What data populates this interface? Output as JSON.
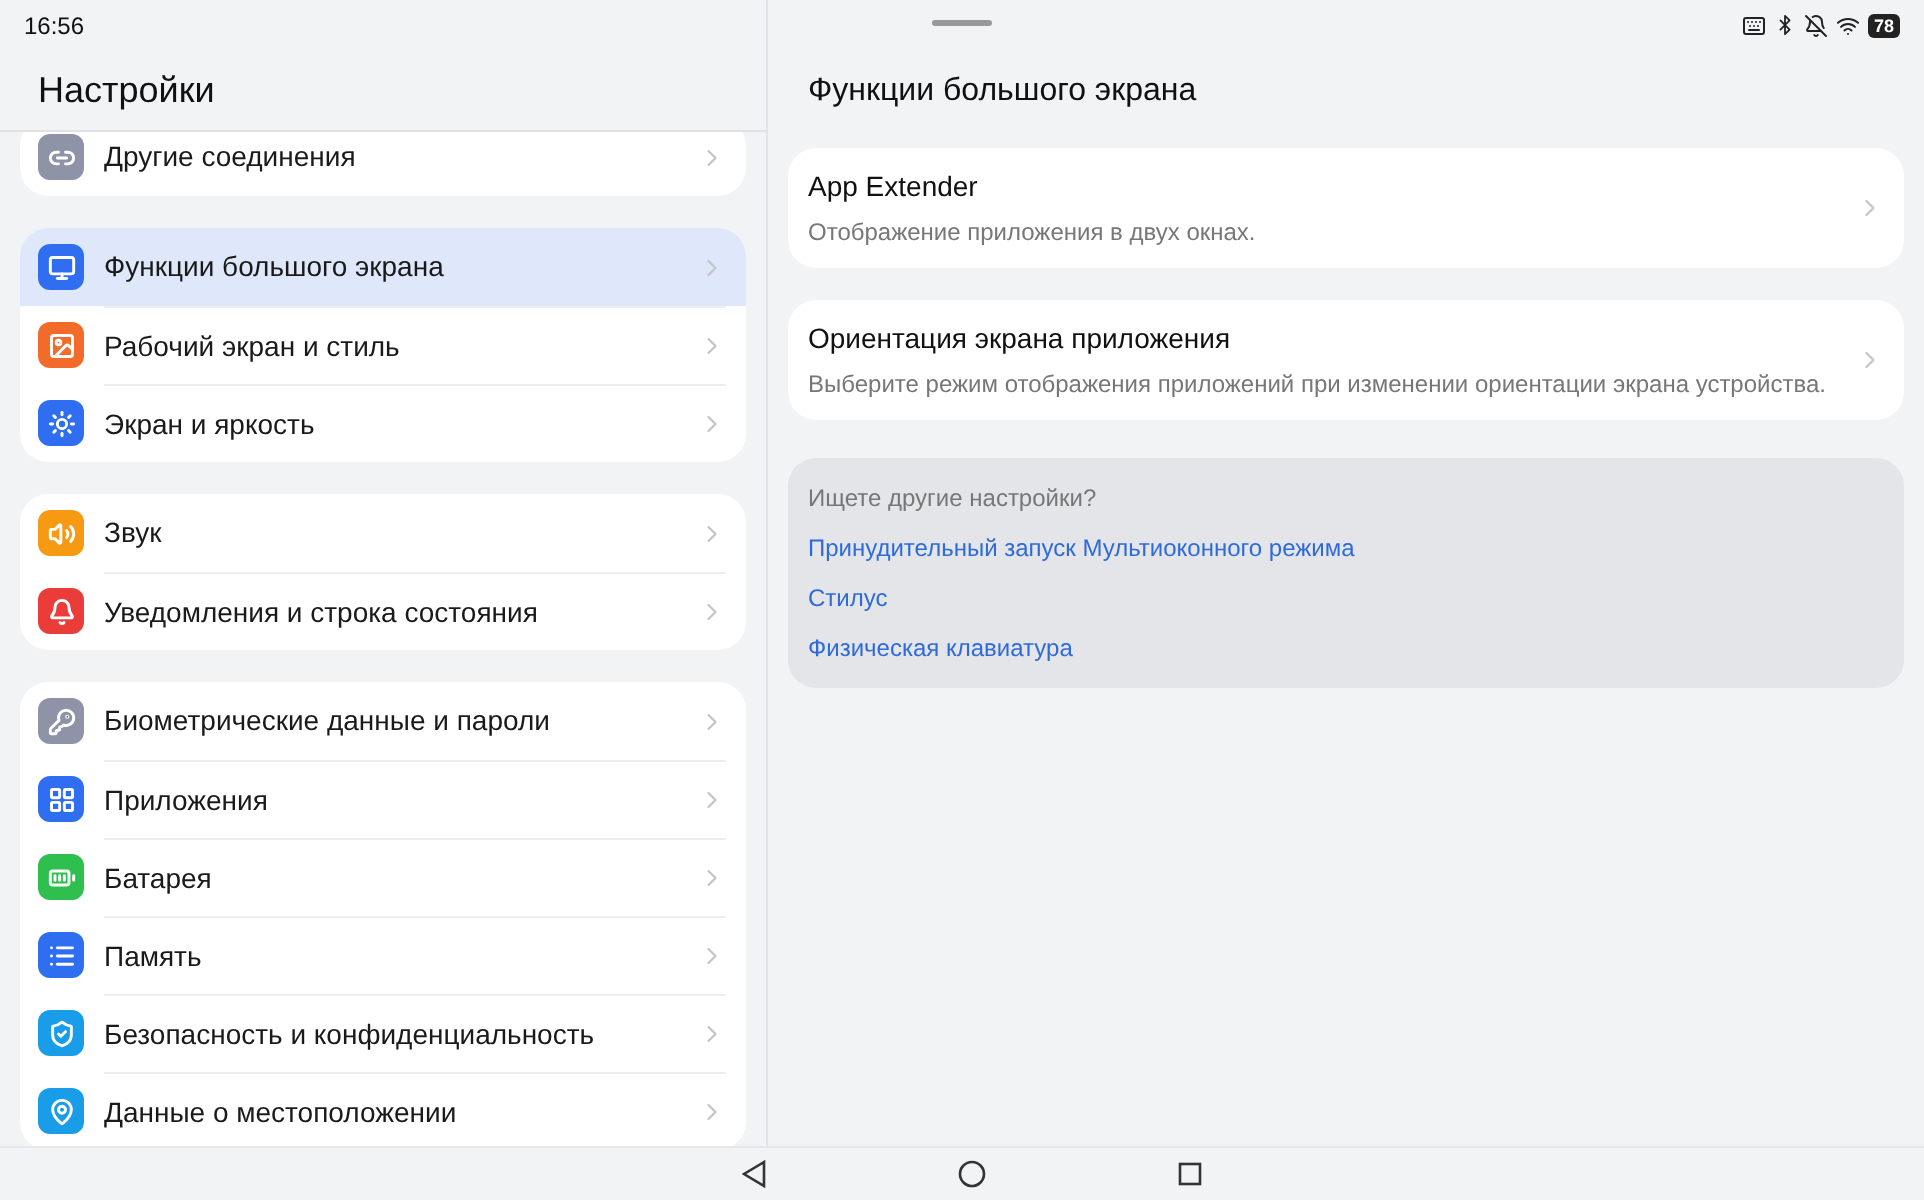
{
  "status_bar": {
    "time": "16:56",
    "battery": "78"
  },
  "sidebar": {
    "title": "Настройки",
    "groups": [
      [
        {
          "label": "Другие соединения",
          "color": "#8e93a8",
          "selected": false
        }
      ],
      [
        {
          "label": "Функции большого экрана",
          "color": "#2f6ef0",
          "selected": true
        },
        {
          "label": "Рабочий экран и стиль",
          "color": "#f36b2a",
          "selected": false
        },
        {
          "label": "Экран и яркость",
          "color": "#2f6ef0",
          "selected": false
        }
      ],
      [
        {
          "label": "Звук",
          "color": "#f79a13",
          "selected": false
        },
        {
          "label": "Уведомления и строка состояния",
          "color": "#ea3d3a",
          "selected": false
        }
      ],
      [
        {
          "label": "Биометрические данные и пароли",
          "color": "#8e93a8",
          "selected": false
        },
        {
          "label": "Приложения",
          "color": "#2f6ef0",
          "selected": false
        },
        {
          "label": "Батарея",
          "color": "#2fbf4f",
          "selected": false
        },
        {
          "label": "Память",
          "color": "#2f6ef0",
          "selected": false
        },
        {
          "label": "Безопасность и конфиденциальность",
          "color": "#1a9de8",
          "selected": false
        },
        {
          "label": "Данные о местоположении",
          "color": "#1a9de8",
          "selected": false
        }
      ]
    ]
  },
  "detail": {
    "title": "Функции большого экрана",
    "cards": [
      {
        "title": "App Extender",
        "subtitle": "Отображение приложения в двух окнах."
      },
      {
        "title": "Ориентация экрана приложения",
        "subtitle": "Выберите режим отображения приложений при изменении ориентации экрана устройства."
      }
    ],
    "suggestions": {
      "heading": "Ищете другие настройки?",
      "links": [
        "Принудительный запуск Мультиоконного режима",
        "Стилус",
        "Физическая клавиатура"
      ]
    }
  }
}
